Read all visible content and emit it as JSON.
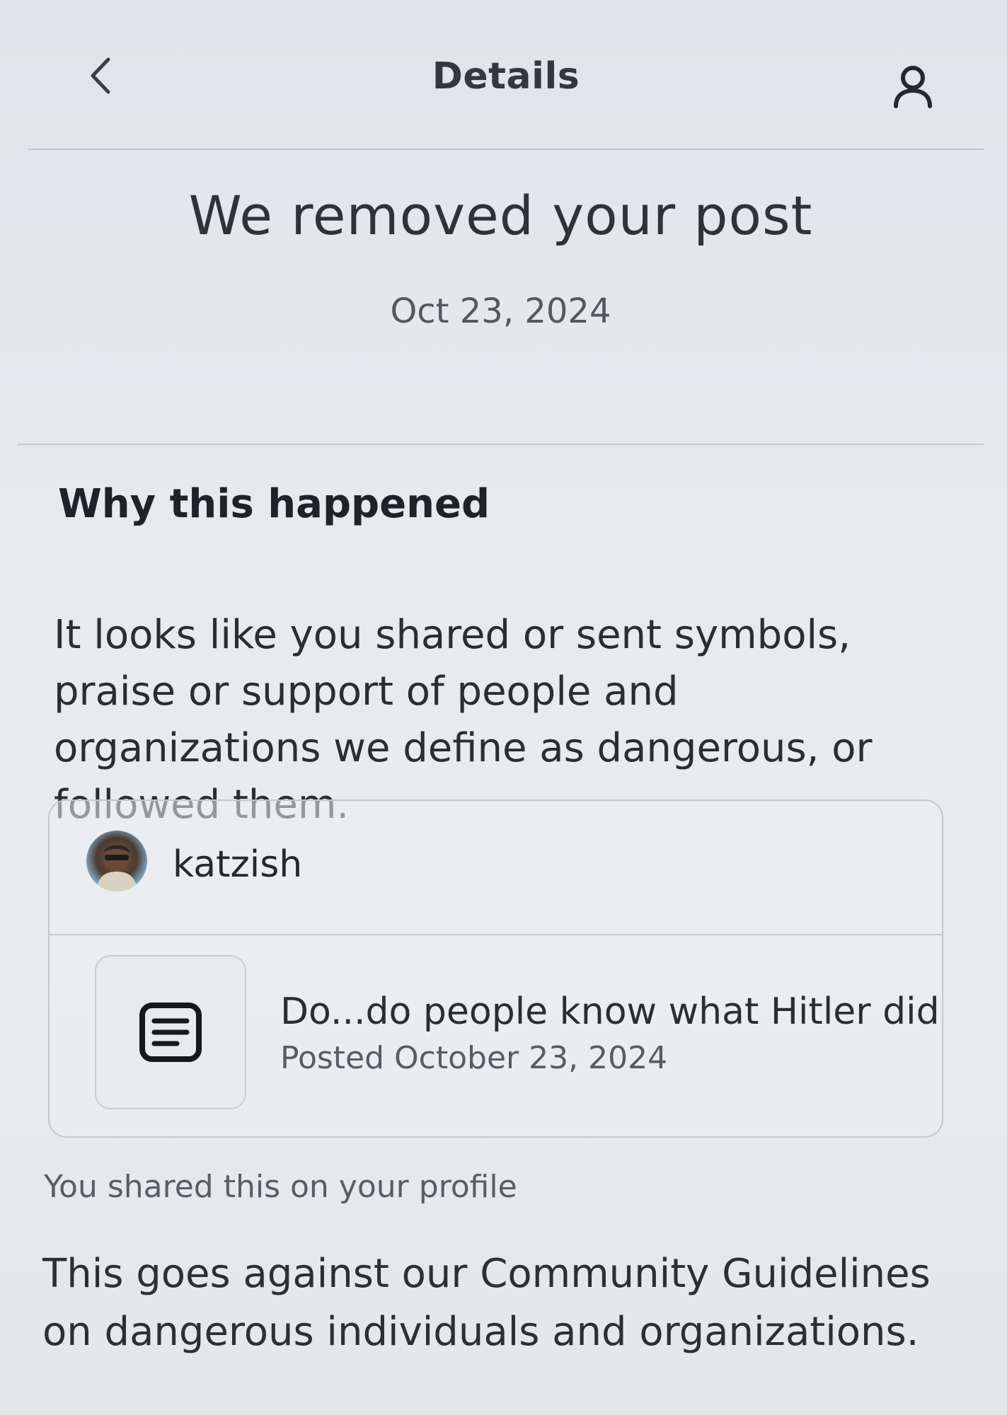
{
  "header": {
    "title": "Details",
    "back_icon": "chevron-left-icon",
    "profile_icon": "person-icon"
  },
  "notice": {
    "title": "We removed your post",
    "date": "Oct 23, 2024"
  },
  "why": {
    "heading": "Why this happened",
    "body": "It looks like you shared or sent symbols, praise or support of people and organizations we define as dangerous, or followed them."
  },
  "post": {
    "username": "katzish",
    "text": "Do...do people know what Hitler did",
    "posted": "Posted October 23, 2024",
    "thumb_icon": "text-post-icon"
  },
  "shared_note": "You shared this on your profile",
  "guidelines": "This goes against our Community Guidelines on dangerous individuals and organizations."
}
